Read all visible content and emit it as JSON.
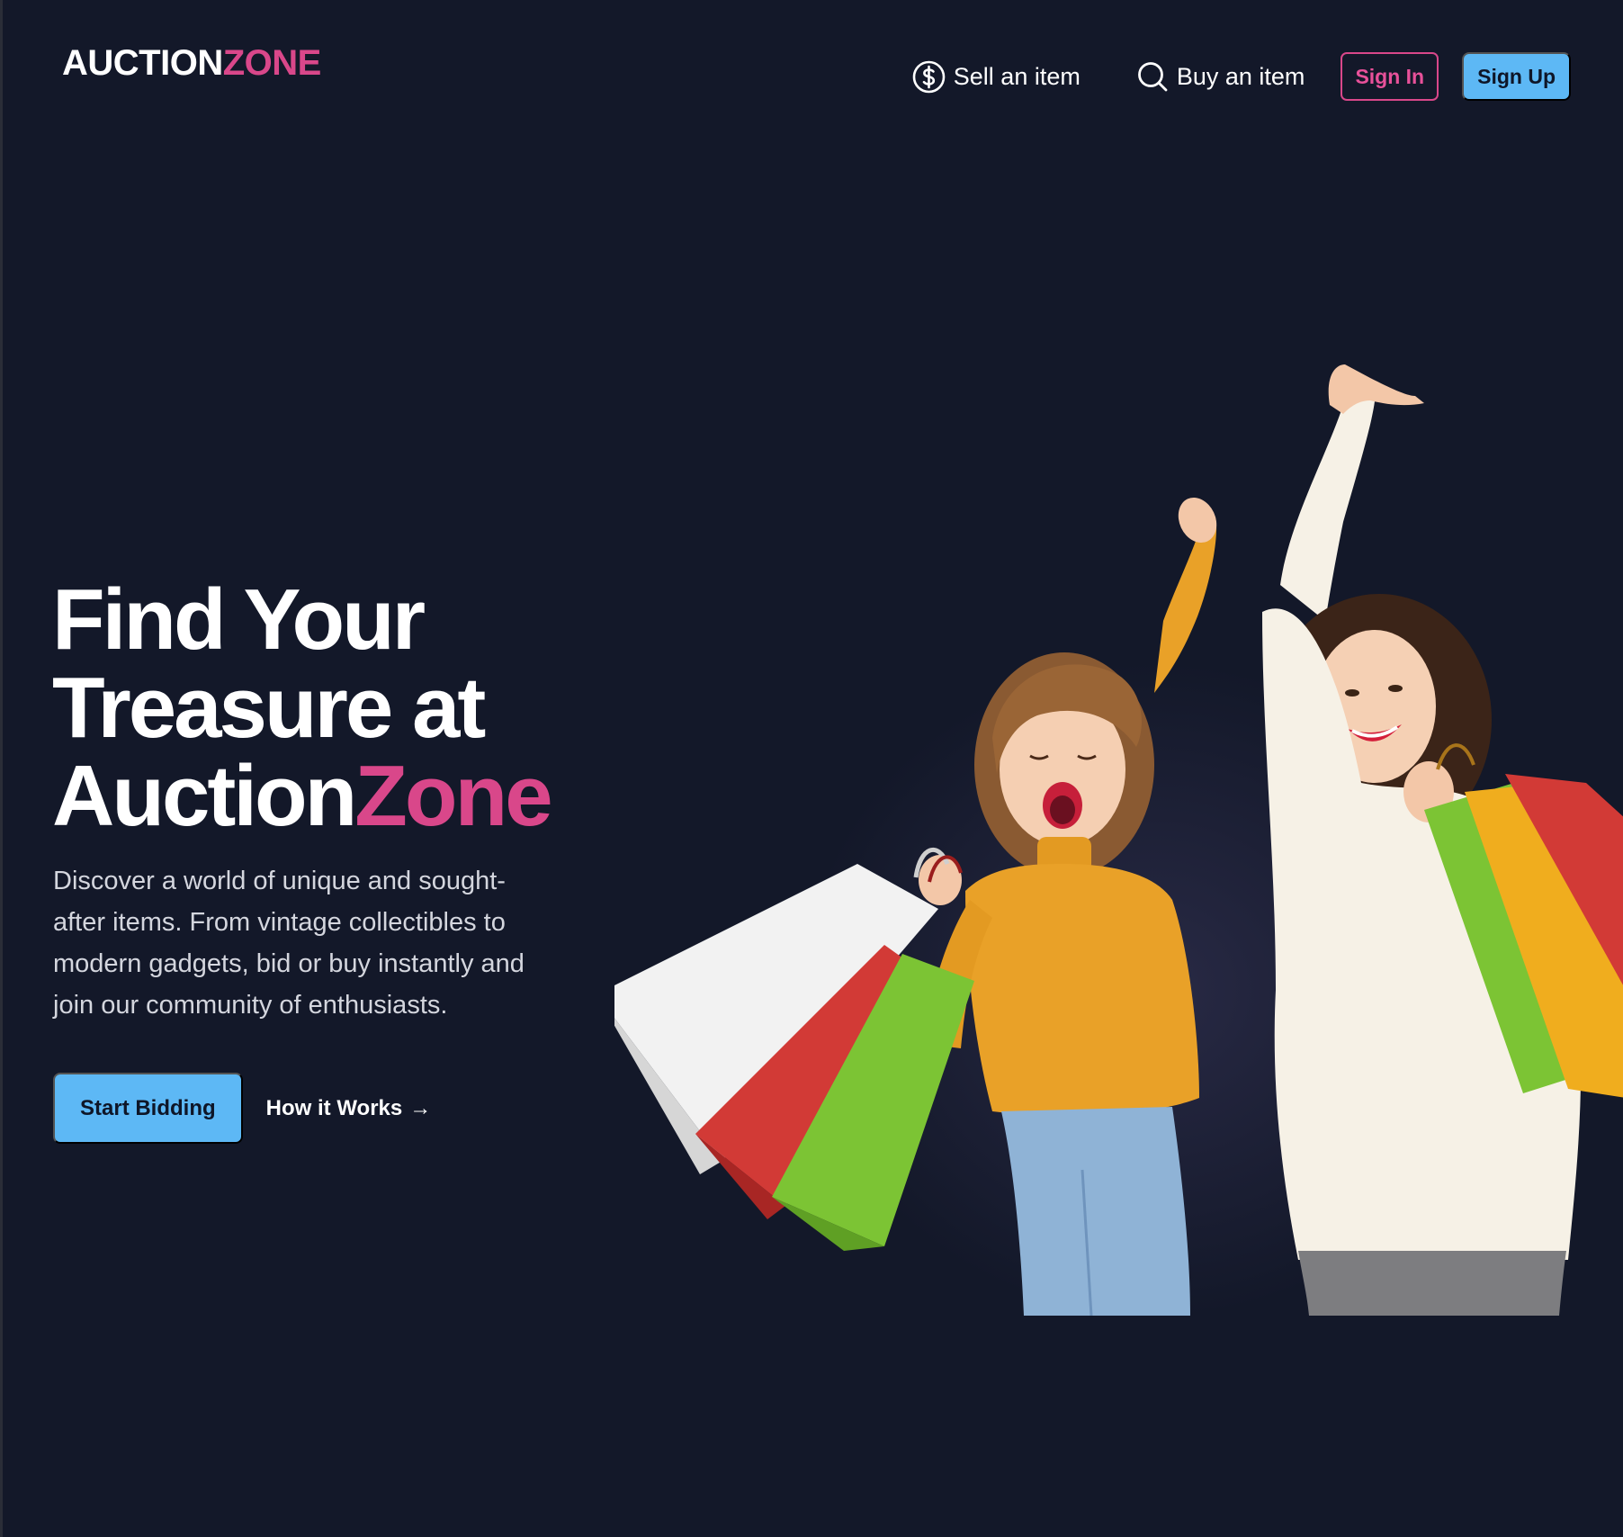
{
  "header": {
    "logo_main": "AUCTION",
    "logo_accent": "ZONE",
    "nav": {
      "sell_label": "Sell an item",
      "buy_label": "Buy an item",
      "signin_label": "Sign In",
      "signup_label": "Sign Up"
    },
    "icons": {
      "sell": "dollar-circle-icon",
      "buy": "search-icon"
    }
  },
  "hero": {
    "title_line1": "Find Your",
    "title_line2": "Treasure at",
    "title_line3_main": "Auction",
    "title_line3_accent": "Zone",
    "description": "Discover a world of unique and sought-after items. From vintage collectibles to modern gadgets, bid or buy instantly and join our community of enthusiasts.",
    "primary_cta": "Start Bidding",
    "secondary_cta": "How it Works",
    "secondary_cta_arrow": "→"
  },
  "colors": {
    "background": "#131829",
    "accent_pink": "#d9478a",
    "accent_blue": "#5db8f5"
  }
}
